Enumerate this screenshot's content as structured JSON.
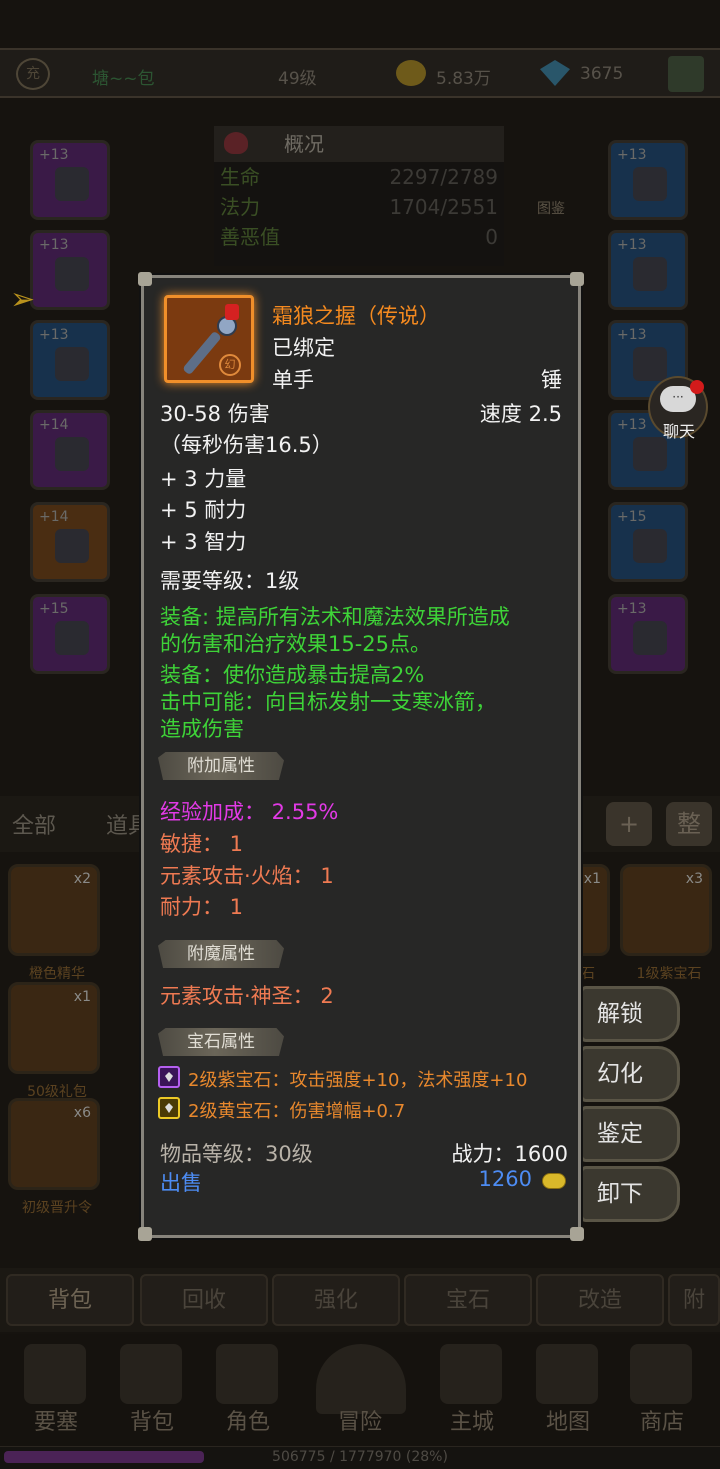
{
  "topbar": {
    "vip": "充",
    "player_name": "塘~~包",
    "level": "49级",
    "gold": "5.83万",
    "diamond": "3675"
  },
  "overview": {
    "title": "概况",
    "rows": [
      {
        "label": "生命",
        "value": "2297/2789"
      },
      {
        "label": "法力",
        "value": "1704/2551"
      },
      {
        "label": "善恶值",
        "value": "0"
      }
    ],
    "tujian": "图鉴"
  },
  "slots_left": [
    "+13",
    "+13",
    "+13",
    "+14",
    "+14",
    "+15"
  ],
  "slots_right": [
    "+13",
    "+13",
    "+13",
    "+13",
    "+15",
    "+13"
  ],
  "chat": {
    "label": "聊天"
  },
  "filter": {
    "all": "全部",
    "tools": "道具",
    "plus": "+",
    "sort": "整"
  },
  "bag_items": [
    {
      "count": "x2",
      "name": "橙色精华"
    },
    {
      "count": "x1",
      "name": "50级礼包"
    },
    {
      "count": "x6",
      "name": "初级晋升令"
    },
    {
      "count": "x1",
      "name": "石"
    },
    {
      "count": "x3",
      "name": "1级紫宝石"
    }
  ],
  "actions": [
    "解锁",
    "幻化",
    "鉴定",
    "卸下"
  ],
  "tooltip": {
    "name": "霜狼之握（传说）",
    "bound": "已绑定",
    "hand": "单手",
    "weapon_type": "锤",
    "damage": "30-58 伤害",
    "speed": "速度 2.5",
    "dps": "（每秒伤害16.5）",
    "stats": [
      "+ 3 力量",
      "+ 5 耐力",
      "+ 3 智力"
    ],
    "req_level": "需要等级：1级",
    "effects": [
      "装备: 提高所有法术和魔法效果所造成",
      "的伤害和治疗效果15-25点。",
      "装备：使你造成暴击提高2%",
      "击中可能：向目标发射一支寒冰箭，",
      "造成伤害"
    ],
    "section_extra": "附加属性",
    "extra_exp": "经验加成：  2.55%",
    "extra_attrs": [
      "敏捷：  1",
      "元素攻击·火焰：  1",
      "耐力：  1"
    ],
    "section_enchant": "附魔属性",
    "enchant_attrs": [
      "元素攻击·神圣：  2"
    ],
    "section_gem": "宝石属性",
    "gems": [
      {
        "text": "2级紫宝石：攻击强度+10，法术强度+10",
        "color": "#b55ff0"
      },
      {
        "text": "2级黄宝石：伤害增幅+0.7",
        "color": "#ecc926"
      }
    ],
    "item_level": "物品等级：30级",
    "power": "战力：1600",
    "sell_label": "出售",
    "sell_price": "1260",
    "icon_badge": "幻"
  },
  "bottom_tabs": [
    "背包",
    "回收",
    "强化",
    "宝石",
    "改造",
    "附"
  ],
  "nav": [
    "要塞",
    "背包",
    "角色",
    "冒险",
    "主城",
    "地图",
    "商店"
  ],
  "xp": "506775 / 1777970 (28%)"
}
